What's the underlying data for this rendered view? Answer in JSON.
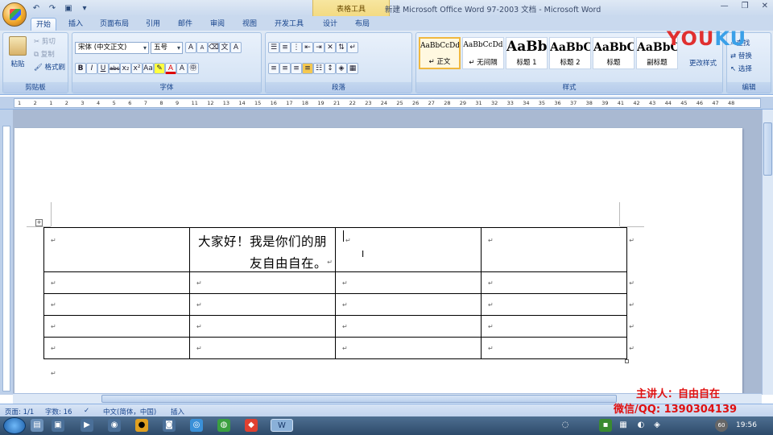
{
  "window": {
    "title": "新建 Microsoft Office Word 97-2003 文档 - Microsoft Word",
    "contextual_tab_group": "表格工具"
  },
  "tabs": [
    "开始",
    "插入",
    "页面布局",
    "引用",
    "邮件",
    "审阅",
    "视图",
    "开发工具",
    "设计",
    "布局"
  ],
  "clipboard": {
    "paste": "粘贴",
    "cut": "剪切",
    "copy": "复制",
    "format_painter": "格式刷",
    "group_label": "剪贴板"
  },
  "font_group": {
    "font_name": "宋体 (中文正文)",
    "font_size": "五号",
    "group_label": "字体"
  },
  "paragraph_group": {
    "group_label": "段落"
  },
  "styles_group": {
    "styles": [
      {
        "preview": "AaBbCcDd",
        "name": "↵ 正文"
      },
      {
        "preview": "AaBbCcDd",
        "name": "↵ 无间隔"
      },
      {
        "preview": "AaBb",
        "name": "标题 1"
      },
      {
        "preview": "AaBbC",
        "name": "标题 2"
      },
      {
        "preview": "AaBbC",
        "name": "标题"
      },
      {
        "preview": "AaBbC",
        "name": "副标题"
      }
    ],
    "change_styles": "更改样式",
    "group_label": "样式"
  },
  "editing_group": {
    "find": "查找",
    "replace": "替换",
    "select": "选择",
    "group_label": "编辑"
  },
  "ruler_numbers": [
    "1",
    "2",
    "1",
    "2",
    "3",
    "4",
    "5",
    "6",
    "7",
    "8",
    "9",
    "11",
    "12",
    "13",
    "14",
    "15",
    "16",
    "17",
    "18",
    "19",
    "21",
    "22",
    "23",
    "24",
    "25",
    "26",
    "27",
    "28",
    "29",
    "31",
    "32",
    "33",
    "34",
    "35",
    "36",
    "37",
    "38",
    "39",
    "41",
    "42",
    "43",
    "44",
    "45",
    "46",
    "47",
    "48"
  ],
  "document": {
    "cell_text": "大家好！我是你们的朋友自由自在。",
    "paragraph_mark": "↵"
  },
  "status": {
    "page": "页面: 1/1",
    "words": "字数: 16",
    "language": "中文(简体，中国)",
    "mode": "插入"
  },
  "watermark": {
    "logo": "YOUKU",
    "presenter": "主讲人：自由自在",
    "contact": "微信/QQ: 1390304139"
  },
  "taskbar": {
    "time": "19:56",
    "tray_number": "60"
  }
}
